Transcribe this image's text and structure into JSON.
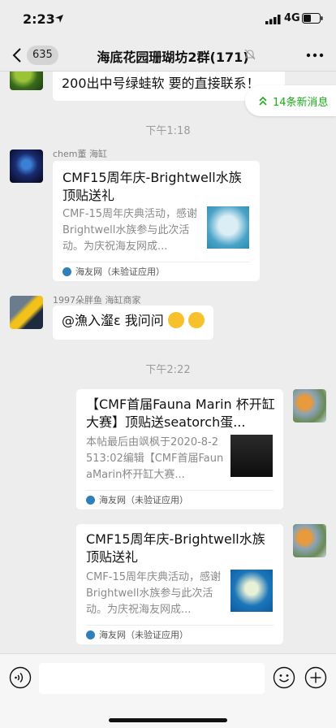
{
  "status": {
    "time": "2:23",
    "network": "4G"
  },
  "nav": {
    "back_count": "635",
    "title": "海底花园珊瑚坊2群(171)"
  },
  "new_messages": {
    "label": "14条新消息"
  },
  "messages": {
    "partial_text": "200出中号绿蛙软 要的直接联系！",
    "time1": "下午1:18",
    "m1": {
      "sender": "chem董 海缸",
      "title": "CMF15周年庆-Brightwell水族顶贴送礼",
      "desc": "CMF-15周年庆典活动，感谢Brightwell水族参与此次活动。为庆祝海友网成...",
      "source": "海友网（未验证应用）"
    },
    "m2": {
      "sender": "1997朵胖鱼 海缸商家",
      "text": "@漁入瀣ε 我问问"
    },
    "time2": "下午2:22",
    "m3": {
      "title": "【CMF首届Fauna Marin 杯开缸大赛】顶贴送seatorch蛋...",
      "desc": "本帖最后由飒枫于2020-8-2513:02编辑【CMF首届FaunaMarin杯开缸大赛...",
      "source": "海友网（未验证应用）"
    },
    "m4": {
      "title": "CMF15周年庆-Brightwell水族顶贴送礼",
      "desc": "CMF-15周年庆典活动，感谢Brightwell水族参与此次活动。为庆祝海友网成...",
      "source": "海友网（未验证应用）"
    }
  },
  "colors": {
    "accent": "#1aad19",
    "background": "#ededed",
    "bubble": "#ffffff"
  }
}
